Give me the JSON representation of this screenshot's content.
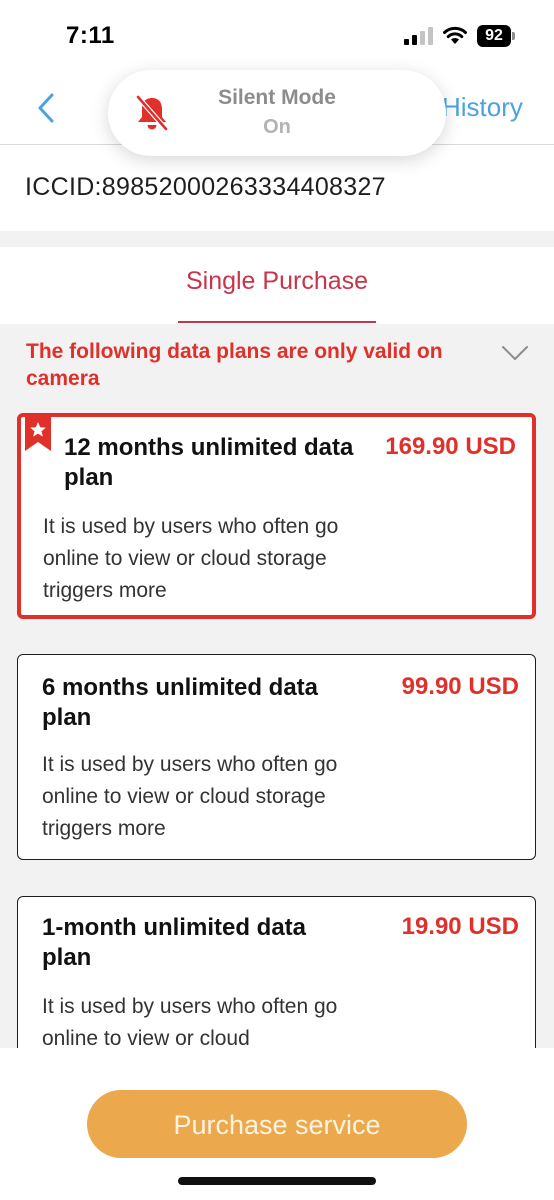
{
  "status_bar": {
    "time": "7:11",
    "battery": "92"
  },
  "nav": {
    "history_label": "History"
  },
  "silent_mode": {
    "title": "Silent Mode",
    "state": "On"
  },
  "device": {
    "iccid": "ICCID:89852000263334408327"
  },
  "tabs": [
    {
      "label": "Single Purchase",
      "active": true
    }
  ],
  "notice": "The following data plans are only valid on camera",
  "plans": [
    {
      "name": "12 months unlimited data plan",
      "price": "169.90 USD",
      "description": "It is used by users who often go online to view or cloud storage triggers more",
      "selected": true,
      "recommended": true
    },
    {
      "name": "6 months unlimited data plan",
      "price": "99.90 USD",
      "description": "It is used by users who often go online to view or cloud storage triggers more",
      "selected": false,
      "recommended": false
    },
    {
      "name": "1-month unlimited data plan",
      "price": "19.90 USD",
      "description": "It is used by users who often go online to view or cloud",
      "selected": false,
      "recommended": false
    }
  ],
  "purchase_button": "Purchase service",
  "colors": {
    "accent_red": "#e0302a",
    "tab_red": "#c8344a",
    "link_blue": "#4aa3df",
    "button_orange": "#eba84d"
  },
  "icons": {
    "back": "chevron-left-icon",
    "silent": "bell-slash-icon",
    "expand": "chevron-down-icon",
    "recommended": "star-ribbon-icon"
  }
}
